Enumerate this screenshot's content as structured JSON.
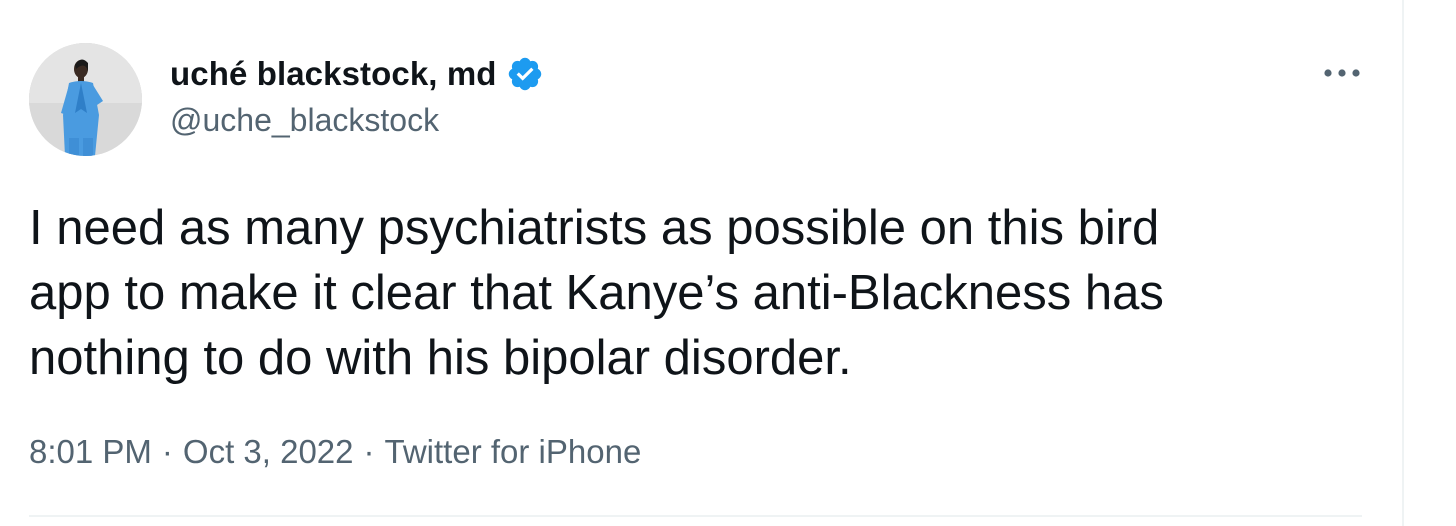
{
  "author": {
    "display_name": "uché blackstock, md",
    "handle": "@uche_blackstock",
    "verified": true,
    "avatar_icon": "profile-photo",
    "verified_icon": "verified-badge-icon",
    "verified_color": "#1d9bf0"
  },
  "menu": {
    "icon": "more-options-icon"
  },
  "tweet": {
    "text": "I need as many psychiatrists as possible on this bird\napp to make it clear that Kanye’s anti-Blackness has\nnothing to do with his bipolar disorder.",
    "time": "8:01 PM",
    "separator": "·",
    "date": "Oct 3, 2022",
    "source": "Twitter for iPhone"
  },
  "colors": {
    "text_primary": "#0f1419",
    "text_secondary": "#536471",
    "divider": "#eff3f4",
    "background": "#ffffff"
  }
}
